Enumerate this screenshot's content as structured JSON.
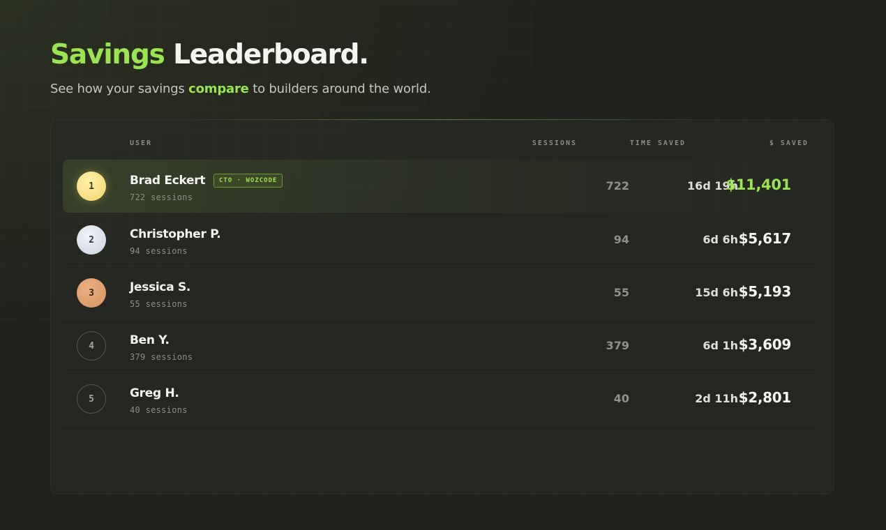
{
  "header": {
    "title_accent": "Savings",
    "title_rest": "Leaderboard.",
    "subtitle_before": "See how your savings",
    "subtitle_accent": "compare",
    "subtitle_after": "to builders around the world."
  },
  "table": {
    "columns": {
      "user": "USER",
      "sessions": "SESSIONS",
      "time_saved": "TIME SAVED",
      "saved": "$ SAVED"
    },
    "rows": [
      {
        "rank": "1",
        "name": "Brad Eckert",
        "tag": "CTO · WOZCODE",
        "sub": "722 sessions",
        "sessions": "722",
        "time_saved": "16d 19h",
        "saved": "$11,401",
        "medal": "gold"
      },
      {
        "rank": "2",
        "name": "Christopher P.",
        "tag": "",
        "sub": "94 sessions",
        "sessions": "94",
        "time_saved": "6d 6h",
        "saved": "$5,617",
        "medal": "silver"
      },
      {
        "rank": "3",
        "name": "Jessica S.",
        "tag": "",
        "sub": "55 sessions",
        "sessions": "55",
        "time_saved": "15d 6h",
        "saved": "$5,193",
        "medal": "bronze"
      },
      {
        "rank": "4",
        "name": "Ben Y.",
        "tag": "",
        "sub": "379 sessions",
        "sessions": "379",
        "time_saved": "6d 1h",
        "saved": "$3,609",
        "medal": "none"
      },
      {
        "rank": "5",
        "name": "Greg H.",
        "tag": "",
        "sub": "40 sessions",
        "sessions": "40",
        "time_saved": "2d 11h",
        "saved": "$2,801",
        "medal": "none"
      }
    ]
  },
  "colors": {
    "accent": "#9be352",
    "background": "#21221d",
    "gold": "#f2d572",
    "silver": "#cdd4de",
    "bronze": "#d69361"
  }
}
